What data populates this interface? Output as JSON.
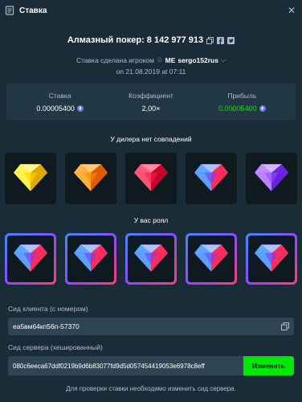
{
  "titlebar": {
    "title": "Ставка"
  },
  "bet": {
    "game_line": "Алмазный покер: 8 142 977 913",
    "placed_by_label": "Ставка сделана игроком",
    "rank": "ME",
    "username": "sergo152rus",
    "date": "on 21.08.2019 at 07:11"
  },
  "stats": {
    "bet_label": "Ставка",
    "bet_value": "0.00005400",
    "multiplier_label": "Коэффициент",
    "multiplier_value": "2,00×",
    "profit_label": "Прибыль",
    "profit_value": "0.00005400"
  },
  "dealer": {
    "title": "У дилера нет совпадений",
    "gems": [
      "yellow",
      "orange",
      "red",
      "blue",
      "purple"
    ]
  },
  "player": {
    "title": "У вас роял",
    "gems": [
      "blue",
      "blue",
      "blue",
      "blue",
      "blue"
    ]
  },
  "client_seed": {
    "label": "Сид клиента (с номером)",
    "value": "ea5вм64кп56п-57370"
  },
  "server_seed": {
    "label": "Сид сервера (хешированный)",
    "value": "080c6eeca67ddf0219b9d6b83077fd9d5d057454419053e6978c8eff",
    "button": "Изменить"
  },
  "footer_note": "Для проверки ставки необходимо изменить сид сервера.",
  "colors": {
    "background": "#1a2c38",
    "panel": "#213743",
    "input": "#2f4553",
    "accent_green": "#00e701"
  }
}
